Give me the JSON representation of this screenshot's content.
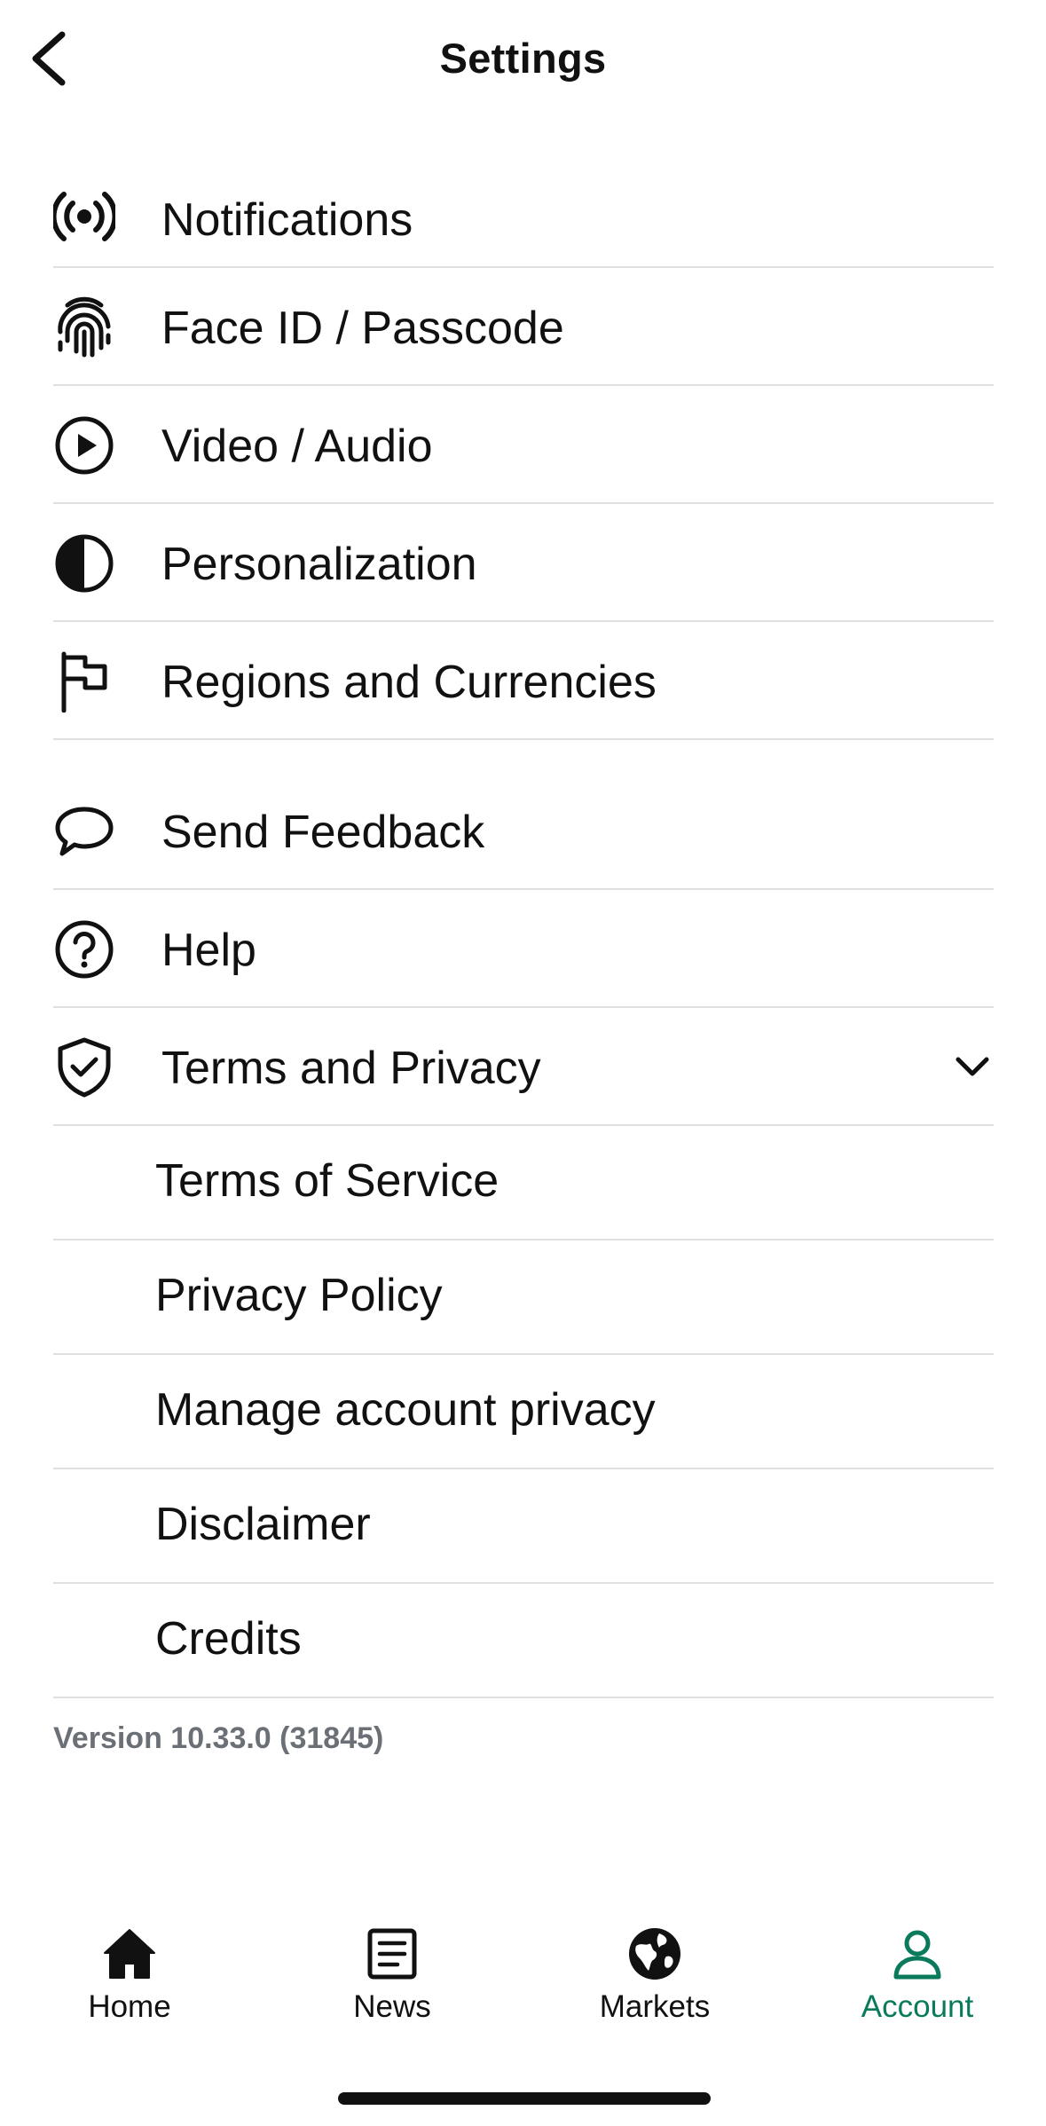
{
  "header": {
    "title": "Settings",
    "back_icon": "chevron-left-icon"
  },
  "settings_group_1": [
    {
      "label": "Notifications",
      "icon": "broadcast-icon"
    },
    {
      "label": "Face ID / Passcode",
      "icon": "fingerprint-icon"
    },
    {
      "label": "Video / Audio",
      "icon": "play-circle-icon"
    },
    {
      "label": "Personalization",
      "icon": "contrast-icon"
    },
    {
      "label": "Regions and Currencies",
      "icon": "flag-icon"
    }
  ],
  "settings_group_2": [
    {
      "label": "Send Feedback",
      "icon": "speech-bubble-icon"
    },
    {
      "label": "Help",
      "icon": "question-circle-icon"
    },
    {
      "label": "Terms and Privacy",
      "icon": "shield-check-icon",
      "expanded": true
    }
  ],
  "terms_submenu": [
    {
      "label": "Terms of Service"
    },
    {
      "label": "Privacy Policy"
    },
    {
      "label": "Manage account privacy"
    },
    {
      "label": "Disclaimer"
    },
    {
      "label": "Credits"
    }
  ],
  "version_text": "Version 10.33.0 (31845)",
  "tabbar": {
    "tabs": [
      {
        "label": "Home",
        "icon": "house-icon",
        "active": false
      },
      {
        "label": "News",
        "icon": "newspaper-icon",
        "active": false
      },
      {
        "label": "Markets",
        "icon": "globe-icon",
        "active": false
      },
      {
        "label": "Account",
        "icon": "person-icon",
        "active": true
      }
    ]
  },
  "colors": {
    "text": "#111111",
    "divider": "#e0e0e0",
    "muted": "#6b6f76",
    "accent": "#0a7a5c"
  }
}
